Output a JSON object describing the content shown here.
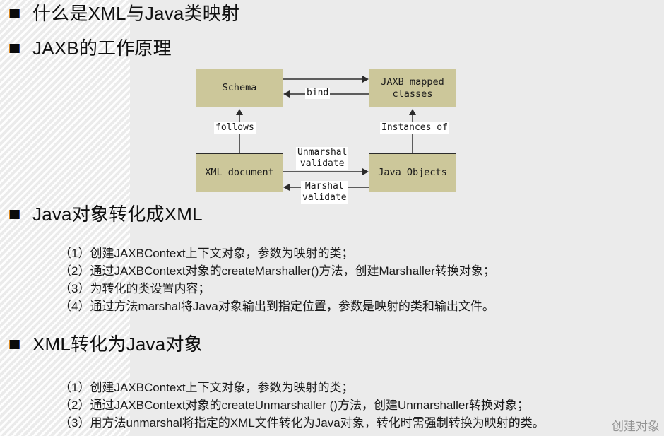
{
  "slide": {
    "background_color": "#ebebeb",
    "hatch_color": "#ffffff"
  },
  "headings": {
    "h1": "什么是XML与Java类映射",
    "h2": "JAXB的工作原理",
    "h3": "Java对象转化成XML",
    "h4": "XML转化为Java对象"
  },
  "diagram": {
    "accent_fill": "#ccc79a",
    "border_color": "#2b2b2b",
    "boxes": {
      "schema": "Schema",
      "jaxb_mapped_classes_line1": "JAXB mapped",
      "jaxb_mapped_classes_line2": "classes",
      "xml_document": "XML document",
      "java_objects": "Java Objects"
    },
    "labels": {
      "bind": "bind",
      "follows": "follows",
      "instances_of": "Instances of",
      "unmarshal_line1": "Unmarshal",
      "unmarshal_line2": "validate",
      "marshal_line1": "Marshal",
      "marshal_line2": "validate"
    }
  },
  "section_marshal": {
    "lines": [
      "（1）创建JAXBContext上下文对象，参数为映射的类；",
      "（2）通过JAXBContext对象的createMarshaller()方法，创建Marshaller转换对象；",
      "（3）为转化的类设置内容；",
      "（4）通过方法marshal将Java对象输出到指定位置，参数是映射的类和输出文件。"
    ]
  },
  "section_unmarshal": {
    "lines": [
      "（1）创建JAXBContext上下文对象，参数为映射的类；",
      "（2）通过JAXBContext对象的createUnmarshaller ()方法，创建Unmarshaller转换对象；",
      "（3）用方法unmarshal将指定的XML文件转化为Java对象，转化时需强制转换为映射的类。"
    ]
  },
  "watermark": {
    "text": "创建对象"
  }
}
